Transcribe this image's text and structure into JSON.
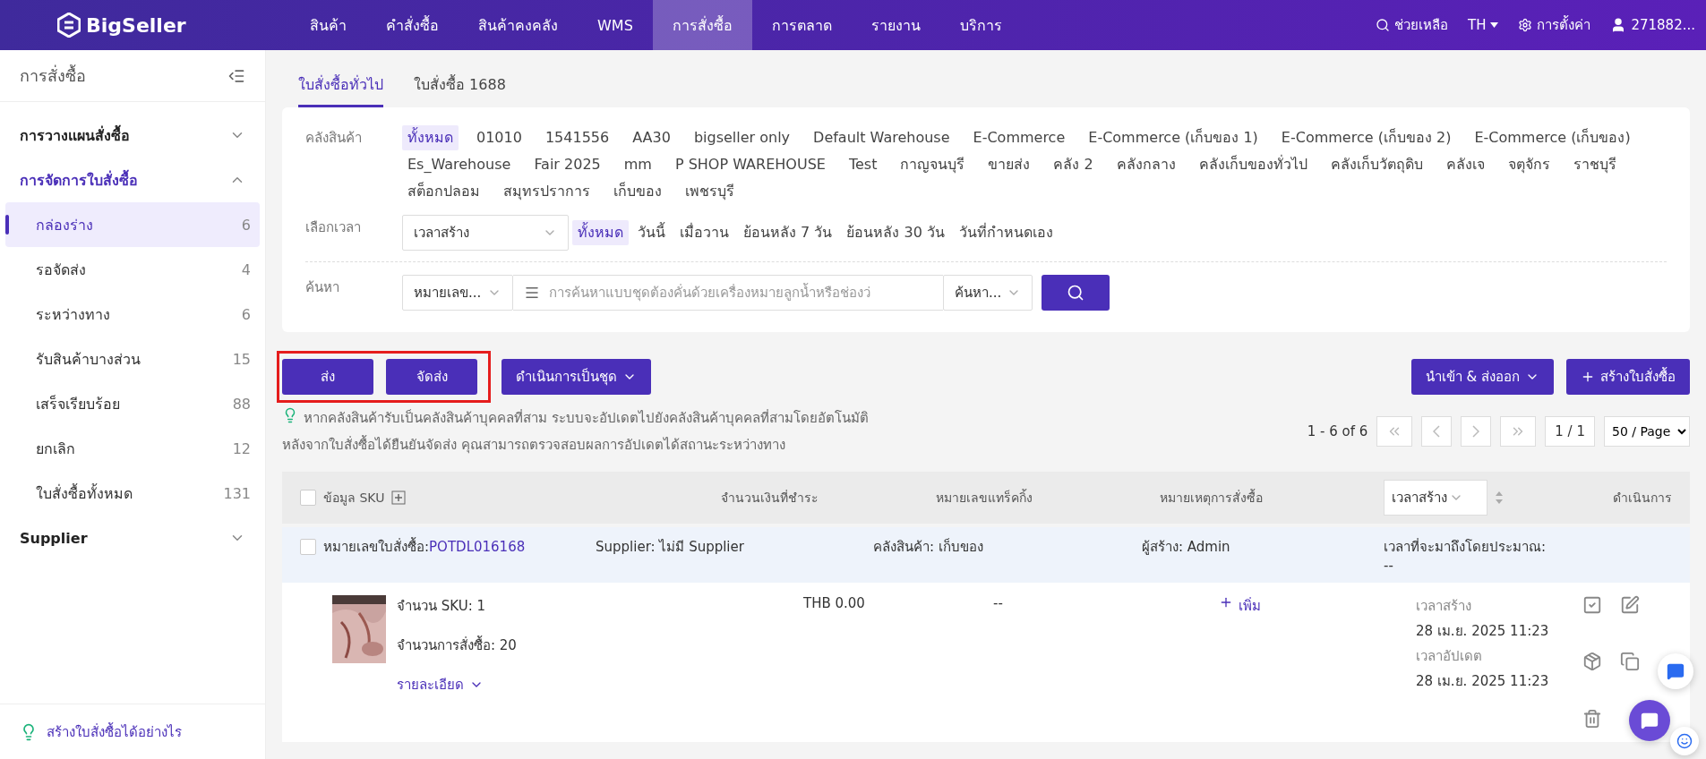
{
  "nav": {
    "logo": "BigSeller",
    "items": [
      {
        "label": "สินค้า",
        "selected": false
      },
      {
        "label": "คำสั่งซื้อ",
        "selected": false
      },
      {
        "label": "สินค้าคงคลัง",
        "selected": false
      },
      {
        "label": "WMS",
        "selected": false
      },
      {
        "label": "การสั่งซื้อ",
        "selected": true
      },
      {
        "label": "การตลาด",
        "selected": false
      },
      {
        "label": "รายงาน",
        "selected": false
      },
      {
        "label": "บริการ",
        "selected": false
      }
    ],
    "help": "ช่วยเหลือ",
    "language": "TH",
    "settings": "การตั้งค่า",
    "user": "271882..."
  },
  "sidebar": {
    "title": "การสั่งซื้อ",
    "groups": [
      {
        "label": "การวางแผนสั่งซื้อ",
        "expanded": false
      },
      {
        "label": "การจัดการใบสั่งซื้อ",
        "expanded": true,
        "children": [
          {
            "label": "กล่องร่าง",
            "count": "6",
            "selected": true
          },
          {
            "label": "รอจัดส่ง",
            "count": "4",
            "selected": false
          },
          {
            "label": "ระหว่างทาง",
            "count": "6",
            "selected": false
          },
          {
            "label": "รับสินค้าบางส่วน",
            "count": "15",
            "selected": false
          },
          {
            "label": "เสร็จเรียบร้อย",
            "count": "88",
            "selected": false
          },
          {
            "label": "ยกเลิก",
            "count": "12",
            "selected": false
          },
          {
            "label": "ใบสั่งซื้อทั้งหมด",
            "count": "131",
            "selected": false
          }
        ]
      },
      {
        "label": "Supplier",
        "expanded": false
      }
    ],
    "footer_link": "สร้างใบสั่งซื้อได้อย่างไร"
  },
  "tabs": [
    {
      "label": "ใบสั่งซื้อทั่วไป",
      "selected": true
    },
    {
      "label": "ใบสั่งซื้อ 1688",
      "selected": false
    }
  ],
  "filters": {
    "warehouse": {
      "label": "คลังสินค้า",
      "options": [
        {
          "label": "ทั้งหมด",
          "selected": true
        },
        {
          "label": "01010",
          "selected": false
        },
        {
          "label": "1541556",
          "selected": false
        },
        {
          "label": "AA30",
          "selected": false
        },
        {
          "label": "bigseller only",
          "selected": false
        },
        {
          "label": "Default Warehouse",
          "selected": false
        },
        {
          "label": "E-Commerce",
          "selected": false
        },
        {
          "label": "E-Commerce (เก็บของ 1)",
          "selected": false
        },
        {
          "label": "E-Commerce (เก็บของ 2)",
          "selected": false
        },
        {
          "label": "E-Commerce (เก็บของ)",
          "selected": false
        },
        {
          "label": "Es_Warehouse",
          "selected": false
        },
        {
          "label": "Fair 2025",
          "selected": false
        },
        {
          "label": "mm",
          "selected": false
        },
        {
          "label": "P SHOP WAREHOUSE",
          "selected": false
        },
        {
          "label": "Test",
          "selected": false
        },
        {
          "label": "กาญจนบุรี",
          "selected": false
        },
        {
          "label": "ขายส่ง",
          "selected": false
        },
        {
          "label": "คลัง 2",
          "selected": false
        },
        {
          "label": "คลังกลาง",
          "selected": false
        },
        {
          "label": "คลังเก็บของทั่วไป",
          "selected": false
        },
        {
          "label": "คลังเก็บวัตถุดิบ",
          "selected": false
        },
        {
          "label": "คลังเจ",
          "selected": false
        },
        {
          "label": "จตุจักร",
          "selected": false
        },
        {
          "label": "ราชบุรี",
          "selected": false
        },
        {
          "label": "สต็อกปลอม",
          "selected": false
        },
        {
          "label": "สมุทรปราการ",
          "selected": false
        },
        {
          "label": "เก็บของ",
          "selected": false
        },
        {
          "label": "เพชรบุรี",
          "selected": false
        }
      ]
    },
    "time": {
      "label": "เลือกเวลา",
      "select": "เวลาสร้าง",
      "options": [
        {
          "label": "ทั้งหมด",
          "selected": true
        },
        {
          "label": "วันนี้",
          "selected": false
        },
        {
          "label": "เมื่อวาน",
          "selected": false
        },
        {
          "label": "ย้อนหลัง 7 วัน",
          "selected": false
        },
        {
          "label": "ย้อนหลัง 30 วัน",
          "selected": false
        },
        {
          "label": "วันที่กำหนดเอง",
          "selected": false
        }
      ]
    },
    "search": {
      "label": "ค้นหา",
      "field": "หมายเลข...",
      "placeholder": "การค้นหาแบบชุดต้องคั่นด้วยเครื่องหมายลูกน้ำหรือช่องว่",
      "mode": "ค้นหา..."
    }
  },
  "toolbar": {
    "actions": [
      "ส่ง",
      "จัดส่ง"
    ],
    "batch": "ดำเนินการเป็นชุด",
    "import_export": "นำเข้า & ส่งออก",
    "create": "สร้างใบสั่งซื้อ"
  },
  "tip": [
    "หากคลังสินค้ารับเป็นคลังสินค้าบุคคลที่สาม ระบบจะอัปเดตไปยังคลังสินค้าบุคคลที่สามโดยอัตโนมัติ",
    "หลังจากใบสั่งซื้อได้ยืนยันจัดส่ง คุณสามารถตรวจสอบผลการอัปเดตได้สถานะระหว่างทาง"
  ],
  "pagination": {
    "range": "1 - 6 of 6",
    "page": "1 / 1",
    "page_size": "50 / Page"
  },
  "table": {
    "select_all": false,
    "columns": [
      "ข้อมูล SKU",
      "จำนวนเงินที่ชำระ",
      "หมายเลขแทร็คกิ้ง",
      "หมายเหตุการสั่งซื้อ",
      "ดำเนินการ"
    ],
    "sort": "เวลาสร้าง",
    "orders": [
      {
        "checked": false,
        "po_label": "หมายเลขใบสั่งซื้อ:",
        "po_number": "POTDL016168",
        "supplier": "Supplier: ไม่มี Supplier",
        "warehouse": "คลังสินค้า: เก็บของ",
        "creator": "ผู้สร้าง: Admin",
        "eta_label": "เวลาที่จะมาถึงโดยประมาณ:",
        "eta": "--",
        "sku_count": "จำนวน SKU: 1",
        "quantity": "จำนวนการสั่งซื้อ: 20",
        "details": "รายละเอียด",
        "amount": "THB 0.00",
        "tracking": "--",
        "note_action": "เพิ่ม",
        "created_label": "เวลาสร้าง",
        "created": "28 เม.ย. 2025 11:23",
        "updated_label": "เวลาอัปเดต",
        "updated": "28 เม.ย. 2025 11:23"
      }
    ]
  }
}
